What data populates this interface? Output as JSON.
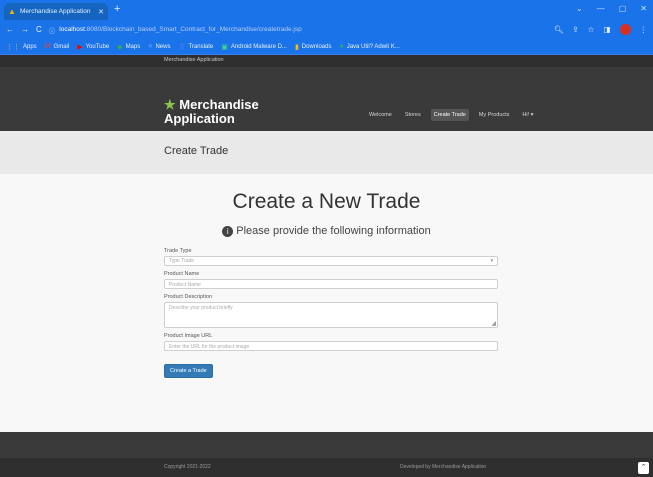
{
  "browser": {
    "tab_title": "Merchandise Application",
    "new_tab": "+",
    "url_host": "localhost",
    "url_path": ":8080/Blockchain_based_Smart_Contract_for_Merchandise/createtrade.jsp",
    "bookmarks": [
      {
        "label": "Apps",
        "icon": "apps-grid-icon",
        "glyph": "⋮⋮",
        "color": "#fbbc05"
      },
      {
        "label": "Gmail",
        "icon": "gmail-icon",
        "glyph": "M",
        "color": "#ea4335"
      },
      {
        "label": "YouTube",
        "icon": "youtube-icon",
        "glyph": "▶",
        "color": "#ff0000"
      },
      {
        "label": "Maps",
        "icon": "maps-icon",
        "glyph": "◆",
        "color": "#34a853"
      },
      {
        "label": "News",
        "icon": "news-icon",
        "glyph": "■",
        "color": "#4285f4"
      },
      {
        "label": "Translate",
        "icon": "translate-icon",
        "glyph": "文",
        "color": "#4285f4"
      },
      {
        "label": "Android Malware D...",
        "icon": "android-icon",
        "glyph": "▣",
        "color": "#3ddc84"
      },
      {
        "label": "Downloads",
        "icon": "folder-icon",
        "glyph": "▮",
        "color": "#fbbc05"
      },
      {
        "label": "Java Util? Adwit K...",
        "icon": "site-icon",
        "glyph": "●",
        "color": "#34a853"
      }
    ]
  },
  "site": {
    "topbar_label": "Merchandise Application",
    "brand_line1": "Merchandise",
    "brand_line2": "Application",
    "nav": [
      "Welcome",
      "Stores",
      "Create Trade",
      "My Products",
      "Hi! ▾"
    ],
    "page_title": "Create Trade"
  },
  "form": {
    "heading": "Create a New Trade",
    "subheading": "Please provide the following information",
    "trade_type_label": "Trade Type",
    "trade_type_value": "Type Trade",
    "product_name_label": "Product Name",
    "product_name_placeholder": "Product Name",
    "product_description_label": "Product Description",
    "product_description_placeholder": "Describe your product briefly",
    "product_image_label": "Product Image URL",
    "product_image_placeholder": "Enter the URL for the product image",
    "submit_label": "Create a Trade"
  },
  "footer": {
    "copyright": "Copyright 2021-2022",
    "credit": "Developed by Merchandise Application"
  },
  "colors": {
    "browser_blue": "#1a73e8",
    "navbar": "#3a3a3a",
    "brand_star": "#8bc34a",
    "button": "#337ab7"
  }
}
